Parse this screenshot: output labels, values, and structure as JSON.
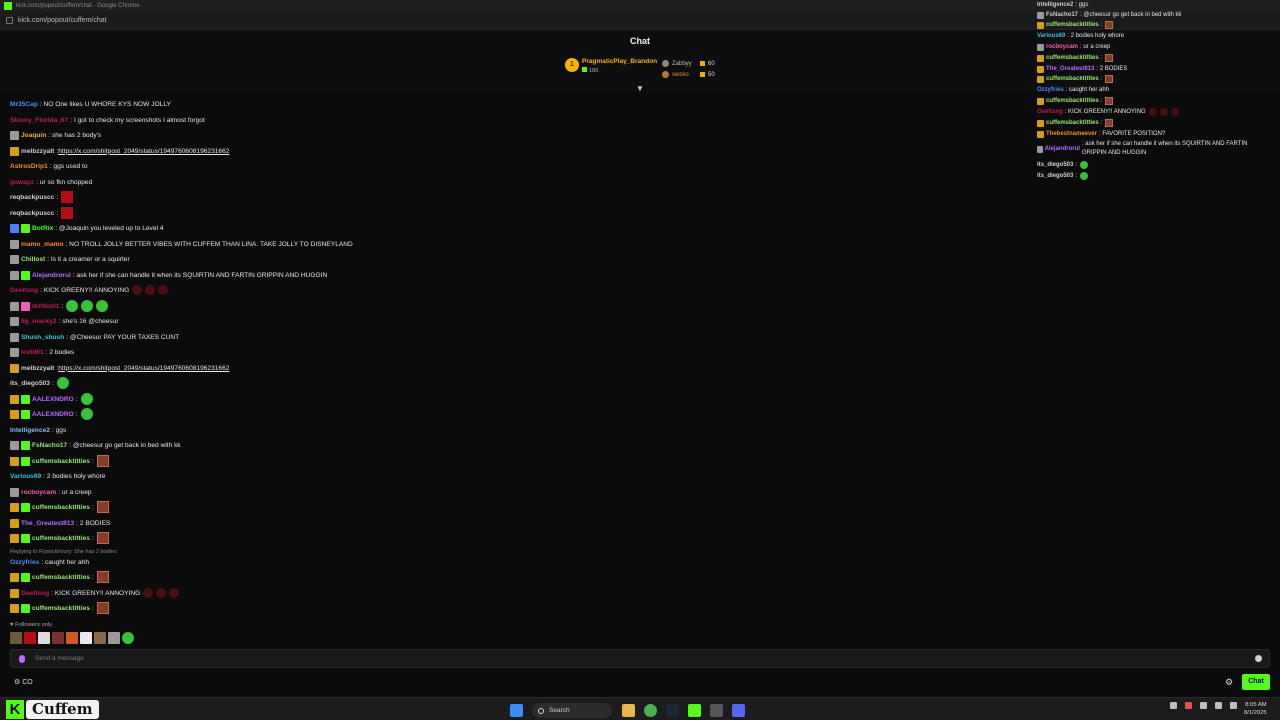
{
  "browser": {
    "title": "kick.com/popout/cuffem/chat - Google Chrome",
    "url": "kick.com/popout/cuffem/chat"
  },
  "chat": {
    "title": "Chat",
    "leaderboard": {
      "first": {
        "rank": "1",
        "name": "PragmaticPlay_Brandon",
        "value": "100"
      },
      "others": [
        {
          "name": "Zabbyy",
          "value": "60"
        },
        {
          "name": "swsko",
          "value": "50"
        }
      ]
    },
    "followers_only": "Followers only",
    "reply_note": "Replying to Ryanckhoury: She has 2 bodies",
    "input_placeholder": "Send a message",
    "send_button": "Chat",
    "bottom_left": "CO"
  },
  "messages": [
    {
      "user": "Mr35Cap",
      "color": "#4f8bff",
      "text": ": NO One likes U WHORE KYS NOW JOLLY",
      "badges": [],
      "emotes": []
    },
    {
      "user": "Skinny_Florida_67",
      "color": "#c2185b",
      "text": ": I got to check my screenshots I almost forgot",
      "badges": [],
      "emotes": []
    },
    {
      "user": "Joaquin",
      "color": "#e8b04a",
      "text": ": she has 2 body's",
      "badges": [
        "mod"
      ],
      "emotes": []
    },
    {
      "user": "melbzzyalt",
      "color": "#cfcfcf",
      "text": ": ",
      "link": "https://x.com/shitpost_2049/status/1949760608196231662",
      "badges": [
        "sub"
      ],
      "emotes": []
    },
    {
      "user": "AstrosDrip1",
      "color": "#f08b2a",
      "text": ": ggs used to",
      "badges": [],
      "emotes": []
    },
    {
      "user": "guwapz",
      "color": "#c2185b",
      "text": ": ur so fkn chopped",
      "badges": [],
      "emotes": []
    },
    {
      "user": "reqbackpuscc",
      "color": "#cfcfcf",
      "text": ":",
      "badges": [],
      "emotes": [
        "red"
      ]
    },
    {
      "user": "reqbackpuscc",
      "color": "#cfcfcf",
      "text": ":",
      "badges": [],
      "emotes": [
        "red"
      ]
    },
    {
      "user": "BotRix",
      "color": "#53fc18",
      "text": ": @Joaquin you leveled up to Level 4",
      "badges": [
        "bot",
        "gift"
      ],
      "emotes": []
    },
    {
      "user": "mamo_mamo",
      "color": "#f08b2a",
      "text": ": NO TROLL JOLLY BETTER VIBES WITH CUFFEM THAN LINA. TAKE JOLLY TO DISNEYLAND",
      "badges": [
        "mod"
      ],
      "emotes": []
    },
    {
      "user": "Chillost",
      "color": "#9ae66e",
      "text": ": Is it a creamer or a squirter",
      "badges": [
        "mod"
      ],
      "emotes": []
    },
    {
      "user": "Alejandrorul",
      "color": "#b26cff",
      "text": ": ask her if she can handle it when its SQUIRTIN AND FARTIN GRIPPIN AND HUGGIN",
      "badges": [
        "mod",
        "gift"
      ],
      "emotes": []
    },
    {
      "user": "Geeltsng",
      "color": "#c2185b",
      "text": ": KICK GREENY!! ANNOYING",
      "badges": [],
      "emotes": [
        "dark",
        "dark",
        "dark"
      ]
    },
    {
      "user": "drillbo01",
      "color": "#c2185b",
      "text": ":",
      "badges": [
        "mod",
        "pink"
      ],
      "emotes": [
        "green",
        "green",
        "green"
      ]
    },
    {
      "user": "lig_macky2",
      "color": "#c2185b",
      "text": ": she's 16 @cheesur",
      "badges": [
        "mod"
      ],
      "emotes": []
    },
    {
      "user": "Shush_shush",
      "color": "#2ec4d6",
      "text": ": @Cheesur PAY YOUR TAXES CUNT",
      "badges": [
        "mod"
      ],
      "emotes": []
    },
    {
      "user": "lcetd01",
      "color": "#c2185b",
      "text": ": 2 bodies",
      "badges": [
        "mod"
      ],
      "emotes": []
    },
    {
      "user": "melbzzyalt",
      "color": "#cfcfcf",
      "text": ": ",
      "link": "https://x.com/shitpost_2049/status/1949760608196231662",
      "badges": [
        "sub"
      ],
      "emotes": []
    },
    {
      "user": "its_diego503",
      "color": "#cfcfcf",
      "text": ":",
      "badges": [],
      "emotes": [
        "green"
      ]
    },
    {
      "user": "AALEXNDRO",
      "color": "#b26cff",
      "text": ":",
      "badges": [
        "sub",
        "gift"
      ],
      "emotes": [
        "green"
      ]
    },
    {
      "user": "AALEXNDRO",
      "color": "#b26cff",
      "text": ":",
      "badges": [
        "sub",
        "gift"
      ],
      "emotes": [
        "green"
      ]
    },
    {
      "user": "Intelligence2",
      "color": "#8ab4ff",
      "text": ": ggs",
      "badges": [],
      "emotes": []
    },
    {
      "user": "FsNacho17",
      "color": "#9ae66e",
      "text": ": @cheesur go get back in bed with kk",
      "badges": [
        "mod",
        "gift"
      ],
      "emotes": []
    },
    {
      "user": "cuffemsbacktitties",
      "color": "#9ae66e",
      "text": ":",
      "badges": [
        "sub",
        "gift"
      ],
      "emotes": [
        "meme"
      ]
    },
    {
      "user": "Various69",
      "color": "#2ec4d6",
      "text": ": 2 bodies holy whore",
      "badges": [],
      "emotes": []
    },
    {
      "user": "rocboycam",
      "color": "#f25cb2",
      "text": ": ur a creep",
      "badges": [
        "mod"
      ],
      "emotes": []
    },
    {
      "user": "cuffemsbacktitties",
      "color": "#9ae66e",
      "text": ":",
      "badges": [
        "sub",
        "gift"
      ],
      "emotes": [
        "meme"
      ]
    },
    {
      "user": "The_Greatest813",
      "color": "#b26cff",
      "text": ": 2 BODIES",
      "badges": [
        "sub"
      ],
      "emotes": []
    },
    {
      "user": "cuffemsbacktitties",
      "color": "#9ae66e",
      "text": ":",
      "badges": [
        "sub",
        "gift"
      ],
      "emotes": [
        "meme"
      ]
    },
    {
      "user": "Ozzyfries",
      "color": "#4f8bff",
      "text": ": caught her ahh",
      "badges": [],
      "emotes": []
    },
    {
      "user": "cuffemsbacktitties",
      "color": "#9ae66e",
      "text": ":",
      "badges": [
        "sub",
        "gift"
      ],
      "emotes": [
        "meme"
      ]
    },
    {
      "user": "Geeltsng",
      "color": "#c2185b",
      "text": ": KICK GREENY!! ANNOYING",
      "badges": [
        "sub"
      ],
      "emotes": [
        "dark",
        "dark",
        "dark"
      ]
    },
    {
      "user": "cuffemsbacktitties",
      "color": "#9ae66e",
      "text": ":",
      "badges": [
        "sub",
        "gift"
      ],
      "emotes": [
        "meme"
      ]
    }
  ],
  "overlay": [
    {
      "user": "Intelligence2",
      "color": "#cfcfcf",
      "text": ": ggs",
      "badges": [],
      "emotes": []
    },
    {
      "user": "FsNacho17",
      "color": "#cfcfcf",
      "text": ": @cheesur go get back in bed with kk",
      "badges": [
        "mod"
      ],
      "emotes": []
    },
    {
      "user": "cuffemsbacktitties",
      "color": "#9ae66e",
      "text": ":",
      "badges": [
        "sub"
      ],
      "emotes": [
        "meme"
      ]
    },
    {
      "user": "Various69",
      "color": "#2ec4d6",
      "text": ": 2 bodies holy whore",
      "badges": [],
      "emotes": []
    },
    {
      "user": "rocboycam",
      "color": "#f25cb2",
      "text": ": ur a creep",
      "badges": [
        "mod"
      ],
      "emotes": []
    },
    {
      "user": "cuffemsbacktitties",
      "color": "#9ae66e",
      "text": ":",
      "badges": [
        "sub"
      ],
      "emotes": [
        "meme"
      ]
    },
    {
      "user": "The_Greatest813",
      "color": "#b26cff",
      "text": ": 2 BODIES",
      "badges": [
        "sub"
      ],
      "emotes": []
    },
    {
      "user": "cuffemsbacktitties",
      "color": "#9ae66e",
      "text": ":",
      "badges": [
        "sub"
      ],
      "emotes": [
        "meme"
      ]
    },
    {
      "user": "Ozzyfries",
      "color": "#4f8bff",
      "text": ": caught her ahh",
      "badges": [],
      "emotes": []
    },
    {
      "user": "cuffemsbacktitties",
      "color": "#9ae66e",
      "text": ":",
      "badges": [
        "sub"
      ],
      "emotes": [
        "meme"
      ]
    },
    {
      "user": "Geeltsng",
      "color": "#c2185b",
      "text": ": KICK GREENY!! ANNOYING",
      "badges": [],
      "emotes": [
        "dark",
        "dark",
        "dark"
      ]
    },
    {
      "user": "cuffemsbacktitties",
      "color": "#9ae66e",
      "text": ":",
      "badges": [
        "sub"
      ],
      "emotes": [
        "meme"
      ]
    },
    {
      "user": "Thebestnameever",
      "color": "#f08b2a",
      "text": ": FAVORITE POSITION?",
      "badges": [
        "sub"
      ],
      "emotes": []
    },
    {
      "user": "Alejandrorul",
      "color": "#b26cff",
      "text": ": ask her if she can handle it when its SQUIRTIN AND FARTIN GRIPPIN AND HUGGIN",
      "badges": [
        "mod"
      ],
      "emotes": [],
      "wrap": true
    },
    {
      "user": "its_diego503",
      "color": "#cfcfcf",
      "text": ":",
      "badges": [],
      "emotes": [
        "green"
      ]
    },
    {
      "user": "its_diego503",
      "color": "#cfcfcf",
      "text": ":",
      "badges": [],
      "emotes": [
        "green"
      ]
    }
  ],
  "taskbar": {
    "brand_letter": "K",
    "brand_name": "Cuffem",
    "search_label": "Search",
    "time": "8:05 AM",
    "date": "8/1/2025"
  },
  "colors": {
    "kick_green": "#53fc18",
    "background": "#0b0b0c",
    "gold": "#f5b400"
  }
}
